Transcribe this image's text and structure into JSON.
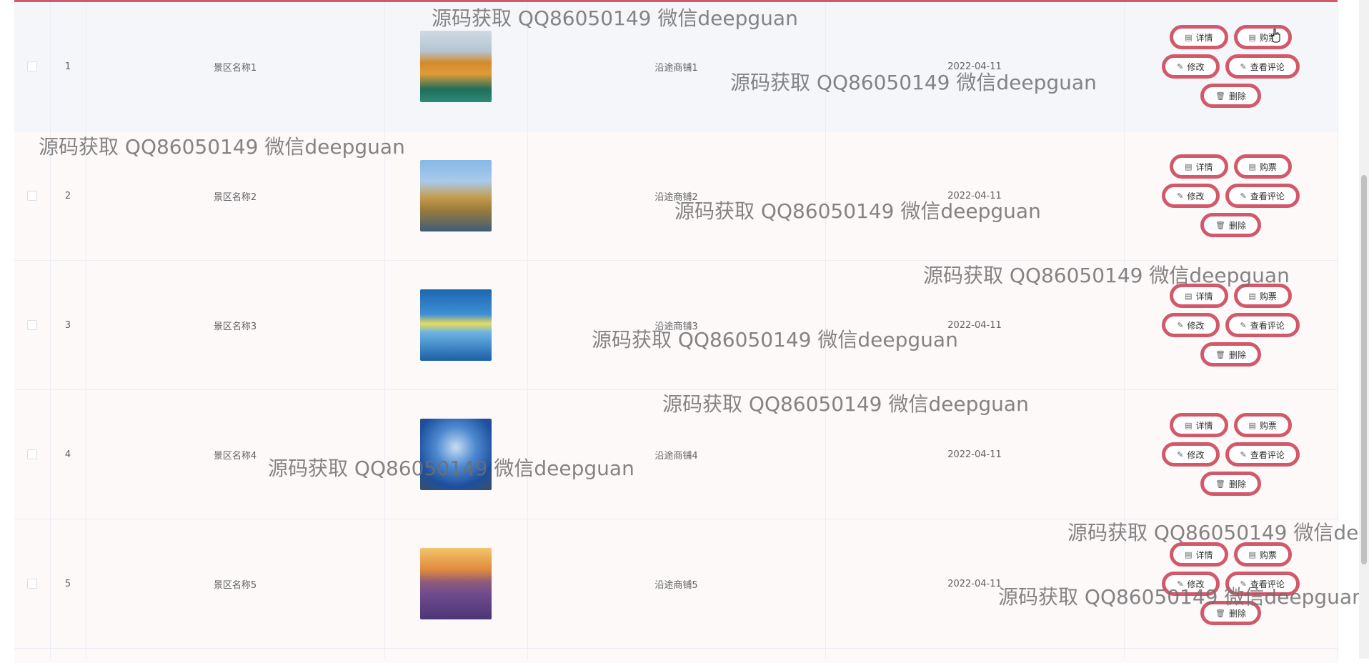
{
  "rows": [
    {
      "index": "1",
      "name": "景区名称1",
      "shop": "沿途商铺1",
      "date": "2022-04-11"
    },
    {
      "index": "2",
      "name": "景区名称2",
      "shop": "沿途商铺2",
      "date": "2022-04-11"
    },
    {
      "index": "3",
      "name": "景区名称3",
      "shop": "沿途商铺3",
      "date": "2022-04-11"
    },
    {
      "index": "4",
      "name": "景区名称4",
      "shop": "沿途商铺4",
      "date": "2022-04-11"
    },
    {
      "index": "5",
      "name": "景区名称5",
      "shop": "沿途商铺5",
      "date": "2022-04-11"
    }
  ],
  "actions": {
    "detail": "详情",
    "buy": "购票",
    "edit": "修改",
    "comments": "查看评论",
    "delete": "删除"
  },
  "watermark": "源码获取 QQ86050149 微信deepguan",
  "colors": {
    "accent": "#d2596a",
    "row_bg": "#fdf9f8",
    "hover_bg": "#f4f6f9"
  }
}
